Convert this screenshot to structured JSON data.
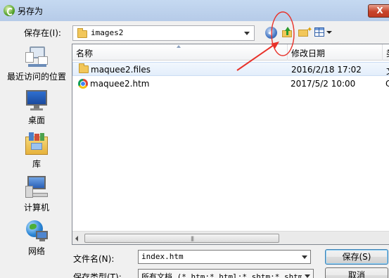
{
  "window": {
    "title": "另存为",
    "close_glyph": "X"
  },
  "toolbar": {
    "save_in_label": "保存在(I):",
    "save_in_value": "images2",
    "icons": [
      "back-icon",
      "up-one-level-icon",
      "new-folder-icon",
      "views-menu-icon"
    ]
  },
  "places": [
    {
      "label": "最近访问的位置",
      "icon": "recent-places-icon"
    },
    {
      "label": "桌面",
      "icon": "desktop-icon"
    },
    {
      "label": "库",
      "icon": "libraries-icon"
    },
    {
      "label": "计算机",
      "icon": "computer-icon"
    },
    {
      "label": "网络",
      "icon": "network-icon"
    }
  ],
  "list": {
    "columns": [
      "名称",
      "修改日期",
      "类"
    ],
    "rows": [
      {
        "name": "maquee2.files",
        "modified": "2016/2/18 17:02",
        "type": "文",
        "icon": "folder-icon",
        "selected": true
      },
      {
        "name": "maquee2.htm",
        "modified": "2017/5/2 10:00",
        "type": "C",
        "icon": "chrome-icon",
        "selected": false
      }
    ],
    "scroll_grip": "|||"
  },
  "fields": {
    "filename_label": "文件名(N):",
    "filename_value": "index.htm",
    "filetype_label": "保存类型(T):",
    "filetype_value": "所有文档 (*.htm;*.html;*.shtm;*.shtml"
  },
  "buttons": {
    "save": "保存(S)",
    "cancel": "取消"
  },
  "annotation": {
    "color": "#e8322a"
  }
}
